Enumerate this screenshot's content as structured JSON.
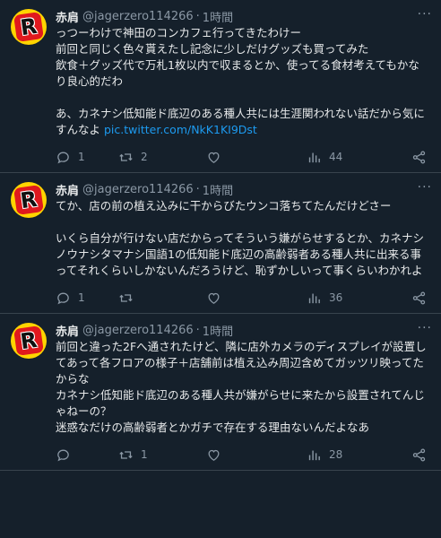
{
  "tweets": [
    {
      "name": "赤肩",
      "handle": "@jagerzero114266",
      "dot": "·",
      "time": "1時間",
      "avatar_letter": "R",
      "text": "っつーわけで神田のコンカフェ行ってきたわけー\n前回と同じく色々貰えたし記念に少しだけグッズも買ってみた\n飲食＋グッズ代で万札1枚以内で収まるとか、使ってる食材考えてもかなり良心的だわ\n\nあ、カネナシ低知能ド底辺のある種人共には生涯関われない話だから気にすんなよ ",
      "link": "pic.twitter.com/NkK1KI9Dst",
      "replies": "1",
      "retweets": "2",
      "likes": "",
      "views": "44"
    },
    {
      "name": "赤肩",
      "handle": "@jagerzero114266",
      "dot": "·",
      "time": "1時間",
      "avatar_letter": "R",
      "text": "てか、店の前の植え込みに干からびたウンコ落ちてたんだけどさー\n\nいくら自分が行けない店だからってそういう嫌がらせするとか、カネナシノウナシタマナシ国語1の低知能ド底辺の高齢弱者ある種人共に出来る事ってそれくらいしかないんだろうけど、恥ずかしいって事くらいわかれよ",
      "link": "",
      "replies": "1",
      "retweets": "",
      "likes": "",
      "views": "36"
    },
    {
      "name": "赤肩",
      "handle": "@jagerzero114266",
      "dot": "·",
      "time": "1時間",
      "avatar_letter": "R",
      "text": "前回と違った2Fへ通されたけど、隣に店外カメラのディスプレイが設置してあって各フロアの様子＋店舗前は植え込み周辺含めてガッツリ映ってたからな\nカネナシ低知能ド底辺のある種人共が嫌がらせに来たから設置されてんじゃねーの？\n迷惑なだけの高齢弱者とかガチで存在する理由ないんだよなあ",
      "link": "",
      "replies": "",
      "retweets": "1",
      "likes": "",
      "views": "28"
    }
  ],
  "icons": {
    "more": "more-dots-icon",
    "reply": "reply-bubble-icon",
    "retweet": "retweet-icon",
    "like": "heart-icon",
    "views": "views-bar-chart-icon",
    "share": "share-icon"
  },
  "colors": {
    "background": "#15202b",
    "text": "#e7e9ea",
    "secondary": "#8b98a5",
    "link": "#1d9bf0",
    "divider": "#38444d",
    "avatar_bg": "#ffd400",
    "avatar_badge": "#e0191e"
  }
}
